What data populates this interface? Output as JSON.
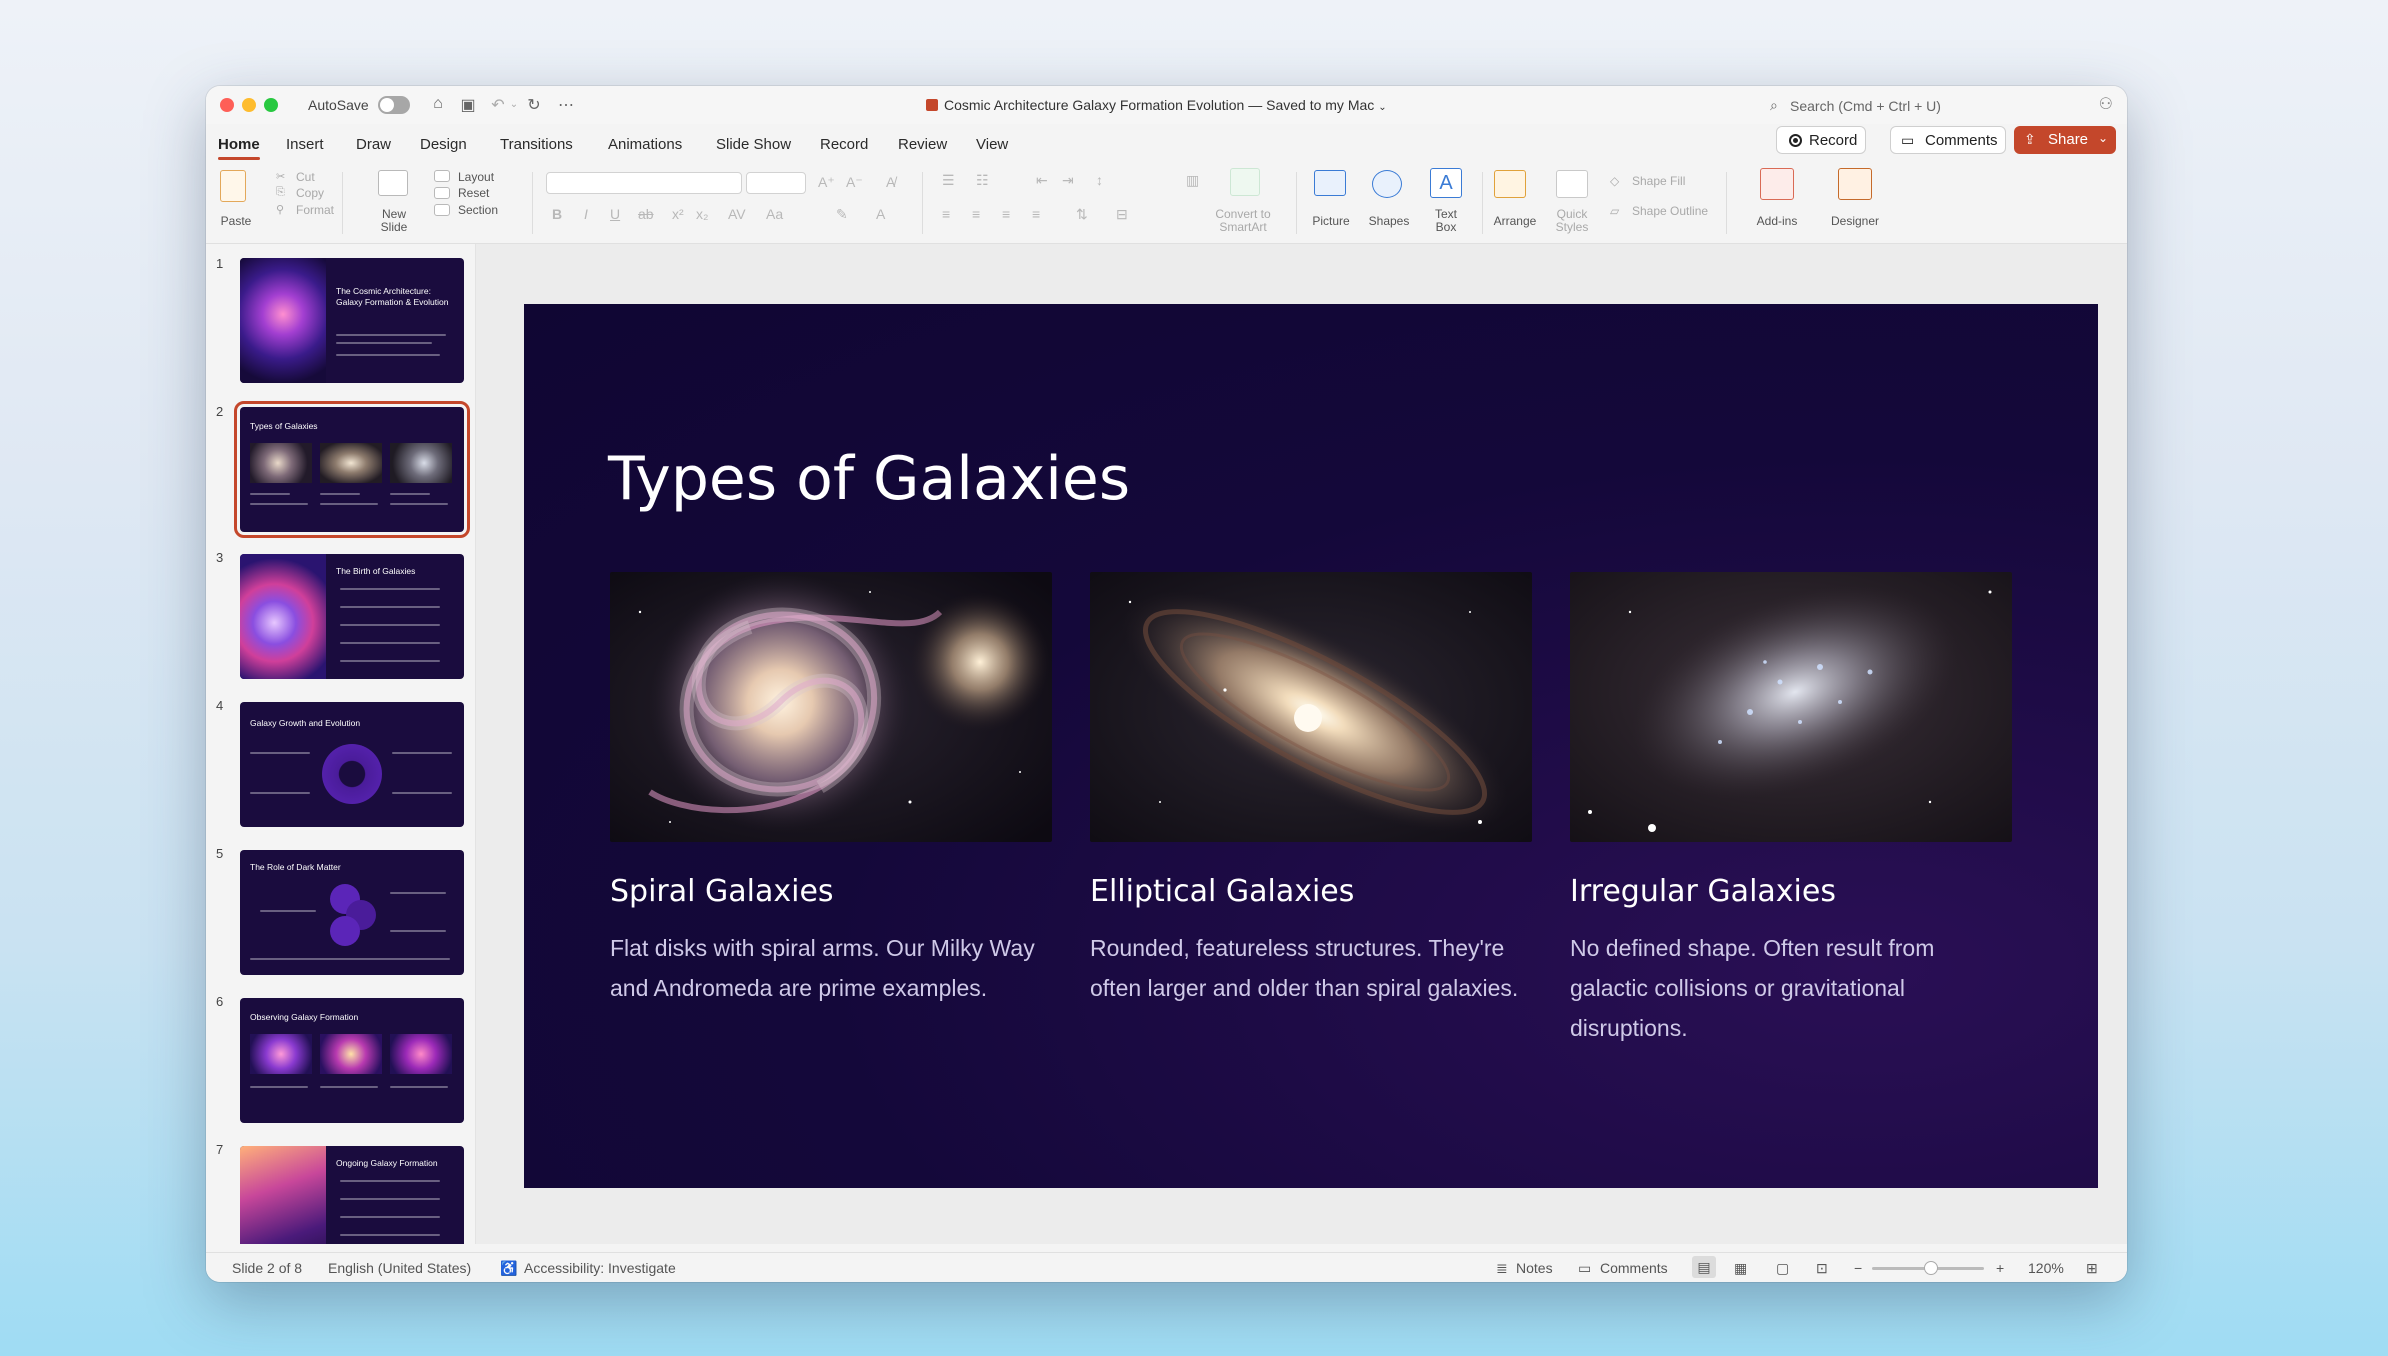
{
  "window": {
    "autosave_label": "AutoSave",
    "document_title": "Cosmic Architecture Galaxy Formation Evolution — Saved to my Mac",
    "search_placeholder": "Search (Cmd + Ctrl + U)"
  },
  "tabs": [
    "Home",
    "Insert",
    "Draw",
    "Design",
    "Transitions",
    "Animations",
    "Slide Show",
    "Record",
    "Review",
    "View"
  ],
  "active_tab": "Home",
  "header_buttons": {
    "record": "Record",
    "comments": "Comments",
    "share": "Share"
  },
  "ribbon": {
    "paste": "Paste",
    "cut": "Cut",
    "copy": "Copy",
    "format": "Format",
    "new_slide_1": "New",
    "new_slide_2": "Slide",
    "layout": "Layout",
    "reset": "Reset",
    "section": "Section",
    "convert_1": "Convert to",
    "convert_2": "SmartArt",
    "picture": "Picture",
    "shapes": "Shapes",
    "text_box_1": "Text",
    "text_box_2": "Box",
    "arrange": "Arrange",
    "quick_styles_1": "Quick",
    "quick_styles_2": "Styles",
    "shape_fill": "Shape Fill",
    "shape_outline": "Shape Outline",
    "add_ins": "Add-ins",
    "designer": "Designer"
  },
  "thumbnails": [
    {
      "num": "1",
      "title": "The Cosmic Architecture: Galaxy Formation & Evolution"
    },
    {
      "num": "2",
      "title": "Types of Galaxies"
    },
    {
      "num": "3",
      "title": "The Birth of Galaxies"
    },
    {
      "num": "4",
      "title": "Galaxy Growth and Evolution"
    },
    {
      "num": "5",
      "title": "The Role of Dark Matter"
    },
    {
      "num": "6",
      "title": "Observing Galaxy Formation"
    },
    {
      "num": "7",
      "title": "Ongoing Galaxy Formation"
    }
  ],
  "selected_slide": 2,
  "slide": {
    "title": "Types of Galaxies",
    "columns": [
      {
        "name": "Spiral Galaxies",
        "description": "Flat disks with spiral arms. Our Milky Way and Andromeda are prime examples."
      },
      {
        "name": "Elliptical Galaxies",
        "description": "Rounded, featureless structures. They're often larger and older than spiral galaxies."
      },
      {
        "name": "Irregular Galaxies",
        "description": "No defined shape. Often result from galactic collisions or gravitational disruptions."
      }
    ]
  },
  "status": {
    "slide_counter": "Slide 2 of 8",
    "language": "English (United States)",
    "accessibility": "Accessibility: Investigate",
    "notes": "Notes",
    "comments": "Comments",
    "zoom_level": "120%"
  },
  "colors": {
    "accent": "#c4472b",
    "slide_bg": "#14083a"
  }
}
